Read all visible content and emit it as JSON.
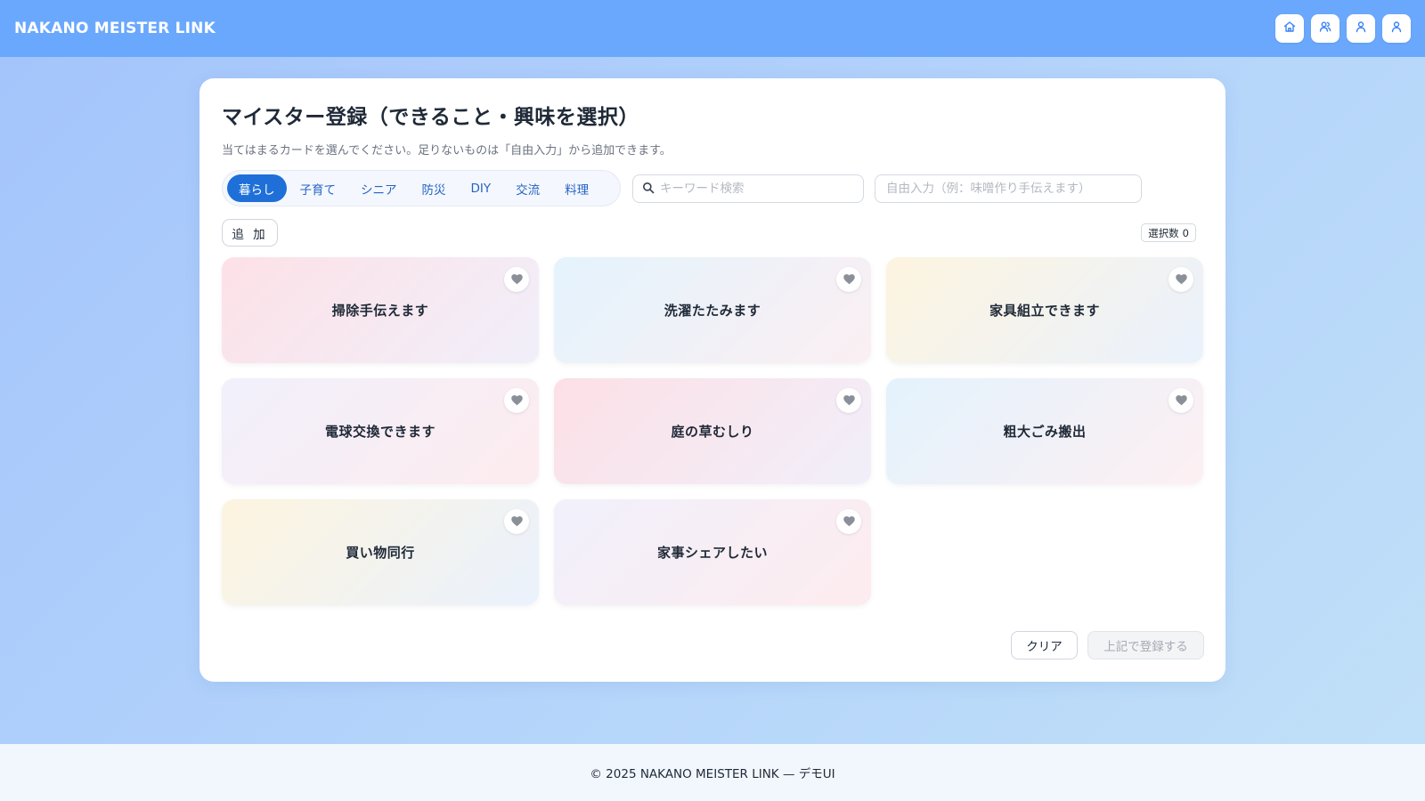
{
  "header": {
    "brand": "NAKANO MEISTER LINK",
    "nav": [
      {
        "icon": "home-icon"
      },
      {
        "icon": "users-icon"
      },
      {
        "icon": "user-icon"
      },
      {
        "icon": "profile-icon"
      }
    ]
  },
  "main": {
    "title": "マイスター登録（できること・興味を選択）",
    "subtitle": "当てはまるカードを選んでください。足りないものは「自由入力」から追加できます。",
    "tabs": [
      {
        "label": "暮らし",
        "active": true
      },
      {
        "label": "子育て",
        "active": false
      },
      {
        "label": "シニア",
        "active": false
      },
      {
        "label": "防災",
        "active": false
      },
      {
        "label": "DIY",
        "active": false
      },
      {
        "label": "交流",
        "active": false
      },
      {
        "label": "料理",
        "active": false
      }
    ],
    "search": {
      "placeholder": "キーワード検索",
      "value": ""
    },
    "free_input": {
      "placeholder": "自由入力（例：味噌作り手伝えます）",
      "value": ""
    },
    "add_label": "追 加",
    "count_label": "選択数",
    "count_value": "0",
    "cards": [
      {
        "label": "掃除手伝えます",
        "gradient": "g-pink"
      },
      {
        "label": "洗濯たたみます",
        "gradient": "g-blue"
      },
      {
        "label": "家具組立できます",
        "gradient": "g-yellow"
      },
      {
        "label": "電球交換できます",
        "gradient": "g-lav"
      },
      {
        "label": "庭の草むしり",
        "gradient": "g-pink2"
      },
      {
        "label": "粗大ごみ搬出",
        "gradient": "g-blue2"
      },
      {
        "label": "買い物同行",
        "gradient": "g-yellow"
      },
      {
        "label": "家事シェアしたい",
        "gradient": "g-lav"
      }
    ],
    "clear_label": "クリア",
    "submit_label": "上記で登録する"
  },
  "footer": {
    "text": "© 2025 NAKANO MEISTER LINK — デモUI"
  },
  "colors": {
    "header_bg": "#6aa8fd",
    "accent": "#1e70d8",
    "tab_text": "#2563c4",
    "heart": "#8a8f98"
  }
}
